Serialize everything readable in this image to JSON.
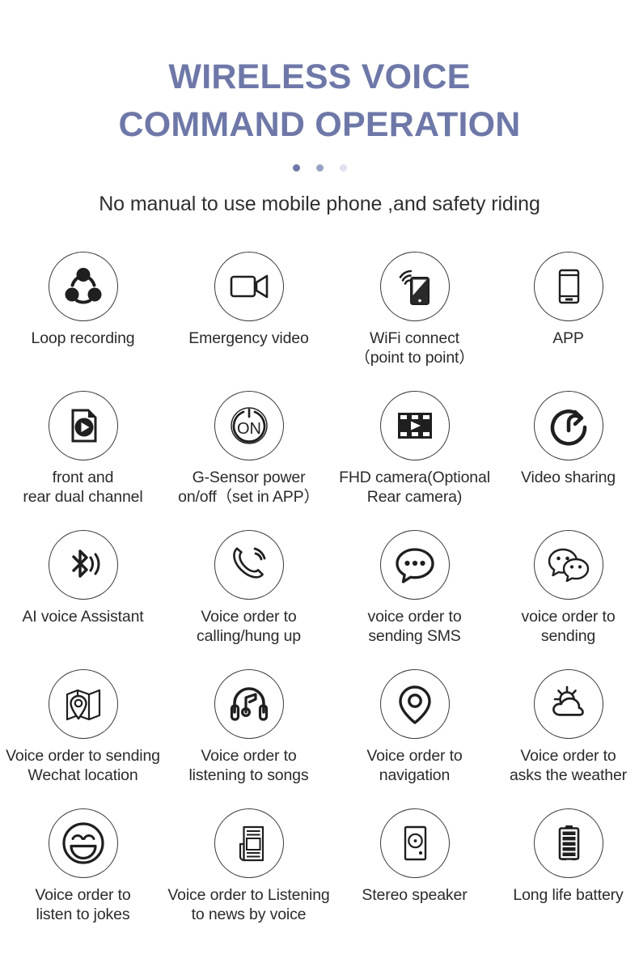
{
  "header": {
    "title_line1": "WIRELESS VOICE",
    "title_line2": "COMMAND OPERATION",
    "title_color": "#6e78a8",
    "subtitle": "No manual to use mobile phone ,and safety riding",
    "pagination_dots": [
      "active",
      "inactive",
      "inactive"
    ]
  },
  "features": [
    {
      "icon": "loop-recording-icon",
      "label": "Loop recording"
    },
    {
      "icon": "video-camera-icon",
      "label": "Emergency video"
    },
    {
      "icon": "wifi-phone-icon",
      "label": "WiFi connect\n（point to point）"
    },
    {
      "icon": "smartphone-app-icon",
      "label": "APP"
    },
    {
      "icon": "video-file-play-icon",
      "label": "front and\nrear dual channel"
    },
    {
      "icon": "power-on-off-icon",
      "label": "G-Sensor power\non/off（set in APP）"
    },
    {
      "icon": "film-strip-play-icon",
      "label": "FHD camera(Optional\nRear camera)"
    },
    {
      "icon": "share-arrow-circle-icon",
      "label": "Video sharing"
    },
    {
      "icon": "bluetooth-voice-icon",
      "label": "AI voice Assistant"
    },
    {
      "icon": "phone-call-icon",
      "label": "Voice order to\ncalling/hung up"
    },
    {
      "icon": "speech-bubble-dots-icon",
      "label": "voice order to\nsending SMS"
    },
    {
      "icon": "wechat-bubbles-icon",
      "label": "voice order to\nsending"
    },
    {
      "icon": "map-location-icon",
      "label": "Voice order to sending\nWechat location"
    },
    {
      "icon": "headphones-music-icon",
      "label": "Voice order to\nlistening to songs"
    },
    {
      "icon": "map-pin-icon",
      "label": "Voice order to\nnavigation"
    },
    {
      "icon": "sun-cloud-weather-icon",
      "label": "Voice order to\nasks the weather"
    },
    {
      "icon": "smiley-face-icon",
      "label": "Voice order to\nlisten to jokes"
    },
    {
      "icon": "newspaper-icon",
      "label": "Voice order to Listening\nto news by voice"
    },
    {
      "icon": "speaker-icon",
      "label": "Stereo speaker"
    },
    {
      "icon": "battery-icon",
      "label": "Long life battery"
    }
  ]
}
